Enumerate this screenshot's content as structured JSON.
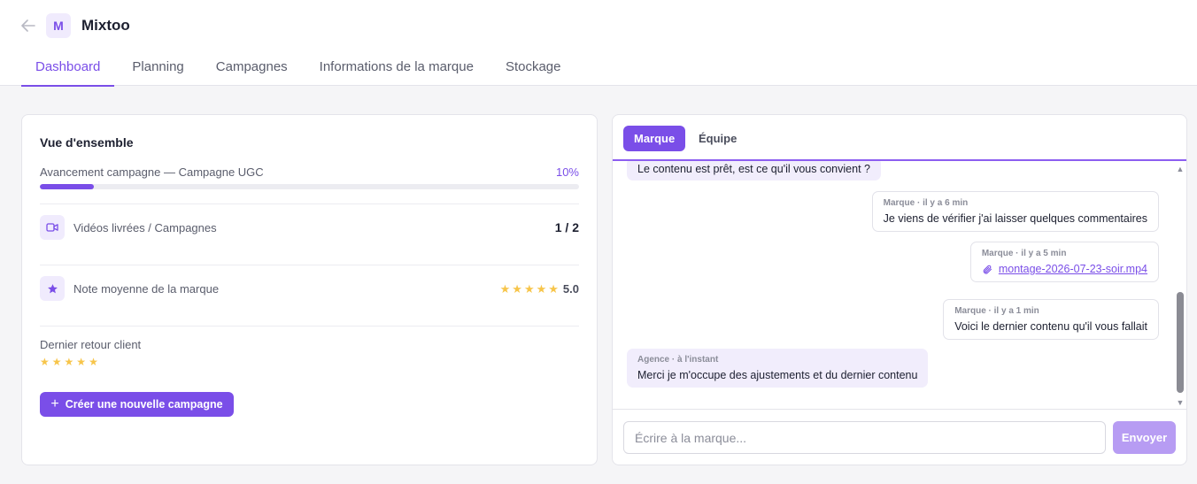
{
  "header": {
    "back_icon": "arrow-left-icon",
    "brand_initial": "M",
    "brand_name": "Mixtoo"
  },
  "tabs": [
    {
      "label": "Dashboard",
      "active": true
    },
    {
      "label": "Planning",
      "active": false
    },
    {
      "label": "Campagnes",
      "active": false
    },
    {
      "label": "Informations de la marque",
      "active": false
    },
    {
      "label": "Stockage",
      "active": false
    }
  ],
  "overview": {
    "title": "Vue d'ensemble",
    "progress_label": "Avancement campagne — Campagne UGC",
    "progress_percent_text": "10%",
    "progress_fraction": 0.1,
    "videos_label": "Vidéos livrées / Campagnes",
    "videos_value": "1 / 2",
    "videos_icon": "video-camera-icon",
    "rating_label": "Note moyenne de la marque",
    "rating_icon": "star-icon",
    "rating_stars": 5,
    "rating_value": "5.0",
    "feedback_label": "Dernier retour client",
    "feedback_stars": 5,
    "create_button": "Créer une nouvelle campagne"
  },
  "chat": {
    "tabs": [
      {
        "label": "Marque",
        "active": true
      },
      {
        "label": "Équipe",
        "active": false
      }
    ],
    "messages": [
      {
        "sender": "agency",
        "meta": "",
        "text": "Le contenu est prêt, est ce qu'il vous convient ?"
      },
      {
        "sender": "brand",
        "meta": "Marque · il y a 6 min",
        "text": "Je viens de vérifier j'ai laisser quelques commentaires"
      },
      {
        "sender": "brand",
        "meta": "Marque · il y a 5 min",
        "attachment": "montage-2026-07-23-soir.mp4"
      },
      {
        "sender": "brand",
        "meta": "Marque · il y a 1 min",
        "text": "Voici le dernier contenu qu'il vous fallait"
      },
      {
        "sender": "agency",
        "meta": "Agence · à l'instant",
        "text": "Merci je m'occupe des ajustements et du dernier contenu"
      }
    ],
    "input_placeholder": "Écrire à la marque...",
    "send_label": "Envoyer"
  },
  "colors": {
    "accent": "#7a4ee8",
    "accent_light": "#f0ebfd",
    "star": "#f7c54a",
    "send_disabled": "#b79cf3"
  }
}
